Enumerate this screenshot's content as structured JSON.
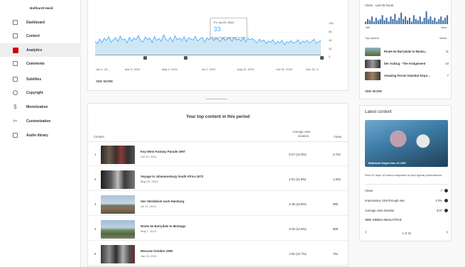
{
  "sidebar": {
    "channel_name": "Bollhardt Heidi",
    "items": [
      {
        "label": "Dashboard",
        "icon": "dashboard-icon"
      },
      {
        "label": "Content",
        "icon": "content-icon"
      },
      {
        "label": "Analytics",
        "icon": "analytics-icon",
        "active": true
      },
      {
        "label": "Comments",
        "icon": "comments-icon"
      },
      {
        "label": "Subtitles",
        "icon": "subtitles-icon"
      },
      {
        "label": "Copyright",
        "icon": "copyright-icon"
      },
      {
        "label": "Monetization",
        "icon": "monetization-icon"
      },
      {
        "label": "Customization",
        "icon": "customization-icon"
      },
      {
        "label": "Audio library",
        "icon": "audio-library-icon"
      }
    ]
  },
  "chart": {
    "tooltip_date": "Fri, Jul 29, 2022",
    "tooltip_value": "33",
    "see_more": "SEE MORE"
  },
  "chart_data": {
    "type": "line",
    "x_ticks": [
      "Jan 1, 20...",
      "Mar 3, 2022",
      "May 2, 2022",
      "Jul 2, 2022",
      "Aug 31, 2022",
      "Oct 31, 2022",
      "Dec 31, 2..."
    ],
    "y_ticks": [
      "100",
      "80",
      "40",
      "20",
      "0"
    ],
    "ylim": [
      0,
      100
    ],
    "accent": "#3ea6ff",
    "fill": "#cfe7f5",
    "values": [
      45,
      38,
      52,
      41,
      55,
      48,
      60,
      42,
      50,
      57,
      44,
      62,
      49,
      53,
      40,
      58,
      46,
      55,
      51,
      64,
      47,
      43,
      59,
      50,
      56,
      41,
      61,
      48,
      54,
      45,
      66,
      52,
      47,
      58,
      43,
      63,
      50,
      55,
      48,
      60,
      44,
      57,
      52,
      49,
      61,
      46,
      53,
      58,
      42,
      56,
      50,
      62,
      47,
      55,
      51,
      44,
      59,
      48,
      53,
      57,
      45,
      60,
      49,
      52,
      46,
      58,
      43,
      55,
      50,
      54,
      47,
      40,
      52,
      44,
      49,
      38,
      46,
      42,
      50,
      36,
      45,
      40,
      48,
      35,
      44,
      41,
      47,
      39,
      43,
      50,
      37,
      46,
      42,
      48,
      40,
      45,
      52,
      38,
      44,
      47
    ]
  },
  "top_content": {
    "title": "Your top content in this period",
    "col_content": "Content",
    "col_avg_l1": "Average view",
    "col_avg_l2": "duration",
    "col_views": "Views",
    "rows": [
      {
        "idx": "1",
        "title": "Key West Fantasy Parade 1997",
        "date": "Oct 20, 2011",
        "dur": "0:27  (14.3%)",
        "views": "2,744"
      },
      {
        "idx": "2",
        "title": "Voyage to Johannesburg South Africa 1972",
        "date": "May 24, 2013",
        "dur": "2:01  (11.9%)",
        "views": "1,916"
      },
      {
        "idx": "3",
        "title": "Von Steckbeck nach Hamburg",
        "date": "Jul 21, 2014",
        "dur": "2:45  (15.8%)",
        "views": "980"
      },
      {
        "idx": "4",
        "title": "Route 62 Barrydale to Montagu",
        "date": "May 7, 2013",
        "dur": "4:03  (14.5%)",
        "views": "858"
      },
      {
        "idx": "5",
        "title": "Moscow October 1990",
        "date": "Jan 19, 2011",
        "dur": "1:02  (12.7%)",
        "views": "781"
      }
    ]
  },
  "realtime": {
    "label": "Views · Last 48 hours",
    "left_tick": "-48h",
    "right_tick": "Now",
    "top_label": "Top content",
    "views_label": "Views",
    "bars": [
      2,
      4,
      3,
      6,
      2,
      5,
      3,
      4,
      7,
      3,
      5,
      2,
      6,
      4,
      8,
      3,
      5,
      9,
      4,
      6,
      3,
      5,
      2,
      7,
      4,
      3,
      6,
      2,
      5,
      10,
      4,
      6,
      3,
      5,
      2,
      4,
      6,
      3,
      5,
      7
    ],
    "items": [
      {
        "title": "Route 62 Barrydale to Monta...",
        "views": "11"
      },
      {
        "title": "Der Aufzug - The Assignment",
        "views": "10"
      },
      {
        "title": "Amazing Ferrari Istanbul Airpo...",
        "views": "7"
      }
    ],
    "see_more": "SEE MORE"
  },
  "latest": {
    "title": "Latest content",
    "caption": "Bollhardt Zeigler Nov 13 1997",
    "desc": "First 22 days 19 hours compared to your typical performance:",
    "stats": [
      {
        "label": "Views",
        "value": "7"
      },
      {
        "label": "Impressions click-through rate",
        "value": "2.2%"
      },
      {
        "label": "Average view duration",
        "value": "3:07"
      }
    ],
    "see_analytics": "SEE VIDEO ANALYTICS",
    "pager": "1 of 10"
  }
}
